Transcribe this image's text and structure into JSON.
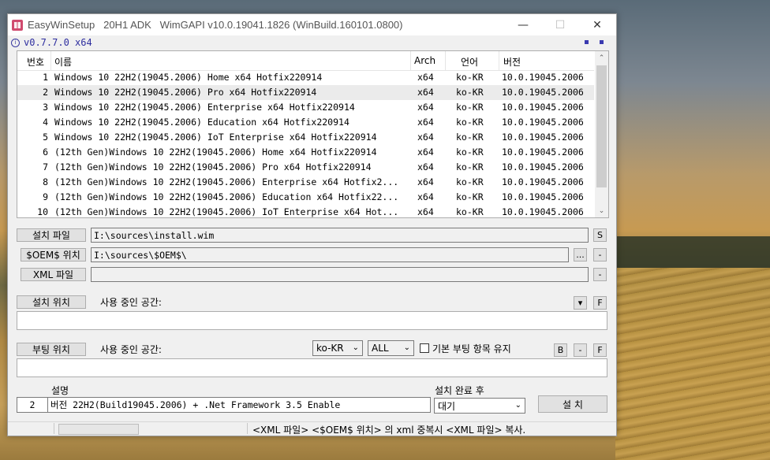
{
  "window": {
    "title": "EasyWinSetup   20H1 ADK   WimGAPI v10.0.19041.1826 (WinBuild.160101.0800)",
    "version": "v0.7.7.0 x64",
    "minimize": "—",
    "maximize": "☐",
    "close": "✕"
  },
  "list": {
    "headers": {
      "no": "번호",
      "name": "이름",
      "arch": "Arch",
      "lang": "언어",
      "ver": "버전"
    },
    "rows": [
      {
        "no": "1",
        "name": "Windows 10 22H2(19045.2006) Home x64 Hotfix220914",
        "arch": "x64",
        "lang": "ko-KR",
        "ver": "10.0.19045.2006"
      },
      {
        "no": "2",
        "name": "Windows 10 22H2(19045.2006) Pro x64 Hotfix220914",
        "arch": "x64",
        "lang": "ko-KR",
        "ver": "10.0.19045.2006"
      },
      {
        "no": "3",
        "name": "Windows 10 22H2(19045.2006) Enterprise x64 Hotfix220914",
        "arch": "x64",
        "lang": "ko-KR",
        "ver": "10.0.19045.2006"
      },
      {
        "no": "4",
        "name": "Windows 10 22H2(19045.2006) Education x64 Hotfix220914",
        "arch": "x64",
        "lang": "ko-KR",
        "ver": "10.0.19045.2006"
      },
      {
        "no": "5",
        "name": "Windows 10 22H2(19045.2006) IoT Enterprise x64 Hotfix220914",
        "arch": "x64",
        "lang": "ko-KR",
        "ver": "10.0.19045.2006"
      },
      {
        "no": "6",
        "name": "(12th Gen)Windows 10 22H2(19045.2006) Home x64 Hotfix220914",
        "arch": "x64",
        "lang": "ko-KR",
        "ver": "10.0.19045.2006"
      },
      {
        "no": "7",
        "name": "(12th Gen)Windows 10 22H2(19045.2006) Pro x64 Hotfix220914",
        "arch": "x64",
        "lang": "ko-KR",
        "ver": "10.0.19045.2006"
      },
      {
        "no": "8",
        "name": "(12th Gen)Windows 10 22H2(19045.2006) Enterprise x64 Hotfix2...",
        "arch": "x64",
        "lang": "ko-KR",
        "ver": "10.0.19045.2006"
      },
      {
        "no": "9",
        "name": "(12th Gen)Windows 10 22H2(19045.2006) Education x64 Hotfix22...",
        "arch": "x64",
        "lang": "ko-KR",
        "ver": "10.0.19045.2006"
      },
      {
        "no": "10",
        "name": "(12th Gen)Windows 10 22H2(19045.2006) IoT Enterprise x64 Hot...",
        "arch": "x64",
        "lang": "ko-KR",
        "ver": "10.0.19045.2006"
      }
    ]
  },
  "install_file": {
    "button": "설치 파일",
    "value": "I:\\sources\\install.wim",
    "side": "S"
  },
  "oem_path": {
    "button": "$OEM$ 위치",
    "value": "I:\\sources\\$OEM$\\",
    "browse": "...",
    "minus": "-"
  },
  "xml_file": {
    "button": "XML 파일",
    "value": "",
    "minus": "-"
  },
  "install_target": {
    "button": "설치 위치",
    "space_label": "사용 중인 공간:",
    "dropdown": "▾",
    "f": "F"
  },
  "boot_target": {
    "button": "부팅 위치",
    "space_label": "사용 중인 공간:",
    "lang_select": "ko-KR",
    "scope_select": "ALL",
    "keep_default_label": "기본 부팅 항목 유지",
    "b": "B",
    "minus": "-",
    "f": "F"
  },
  "description": {
    "label": "설명",
    "no": "2",
    "text": "버전 22H2(Build19045.2006) + .Net Framework 3.5 Enable"
  },
  "after_install": {
    "label": "설치 완료 후",
    "select": "대기",
    "install_button": "설 치"
  },
  "status": {
    "message": "<XML 파일> <$OEM$ 위치> 의 xml 중복시 <XML 파일> 복사."
  }
}
